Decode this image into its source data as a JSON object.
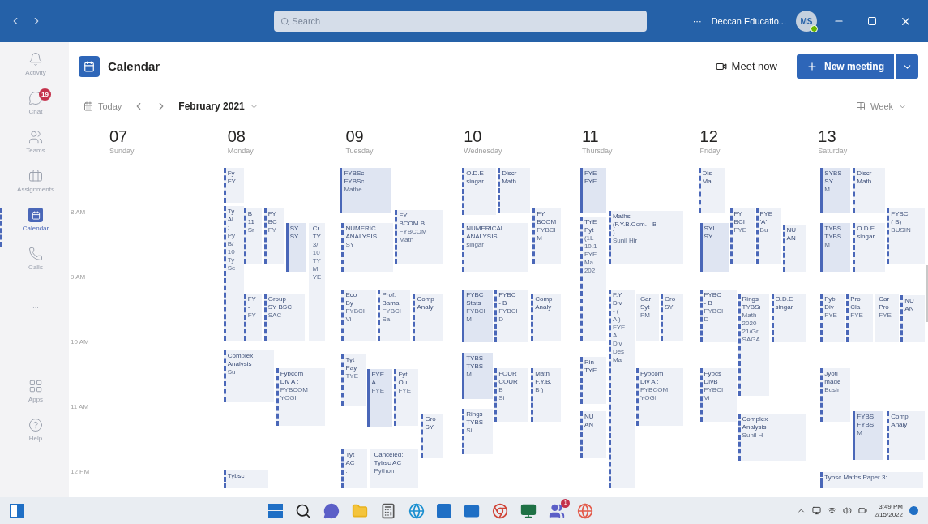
{
  "title_bar": {
    "search_placeholder": "Search",
    "more": "···",
    "org": "Deccan Educatio...",
    "avatar": "MS"
  },
  "rail": [
    {
      "label": "Activity",
      "selected": false
    },
    {
      "label": "Chat",
      "selected": false,
      "badge": "19"
    },
    {
      "label": "Teams",
      "selected": false
    },
    {
      "label": "Assignments",
      "selected": false
    },
    {
      "label": "Calendar",
      "selected": true
    },
    {
      "label": "Calls",
      "selected": false
    },
    {
      "label": "···",
      "selected": false
    },
    {
      "label": "Apps",
      "selected": false
    },
    {
      "label": "Help",
      "selected": false
    }
  ],
  "header": {
    "title": "Calendar",
    "meet_now": "Meet now",
    "new_meeting": "New meeting"
  },
  "toolbar": {
    "today": "Today",
    "month": "February 2021",
    "view": "Week"
  },
  "hours": [
    "8 AM",
    "9 AM",
    "10 AM",
    "11 AM",
    "12 PM"
  ],
  "days": [
    {
      "date": "07",
      "weekday": "Sunday"
    },
    {
      "date": "08",
      "weekday": "Monday",
      "events": [
        {
          "lines": [
            "Fy",
            "FY"
          ],
          "kind": "tentative"
        },
        {
          "lines": [
            "Ty",
            "Al",
            ":",
            "Py",
            "B/",
            "10",
            "Ty",
            "Se"
          ],
          "kind": "tentative"
        },
        {
          "lines": [
            "B",
            "11",
            "Sr"
          ],
          "kind": "tentative"
        },
        {
          "lines": [
            "FY",
            "BC",
            "FY"
          ],
          "kind": "tentative"
        },
        {
          "lines": [
            "SY",
            "SY"
          ],
          "kind": "accepted"
        },
        {
          "lines": [
            "Cr",
            "TY",
            "3/",
            "10",
            "TY",
            "M",
            "YE"
          ],
          "kind": "plain"
        },
        {
          "lines": [
            "FY",
            "-",
            "FY"
          ],
          "kind": "tentative"
        },
        {
          "lines": [
            "Group",
            "SY BSC",
            "SAC"
          ],
          "kind": "tentative"
        },
        {
          "lines": [
            "Complex",
            "Analysis",
            "Su"
          ],
          "kind": "tentative"
        },
        {
          "lines": [
            "Fybcom",
            "Div A :",
            "FYBCOM",
            "YOGI"
          ],
          "kind": "tentative"
        },
        {
          "lines": [
            "Tybsc"
          ],
          "kind": "tentative"
        }
      ]
    },
    {
      "date": "09",
      "weekday": "Tuesday",
      "events": [
        {
          "lines": [
            "FYBSc",
            "FYBSc",
            "Mathe"
          ],
          "kind": "accepted"
        },
        {
          "lines": [
            "FY",
            "BCOM B",
            "FYBCOM",
            "Math"
          ],
          "kind": "tentative"
        },
        {
          "lines": [
            "NUMERIC",
            "ANALYSIS",
            "SY"
          ],
          "kind": "tentative"
        },
        {
          "lines": [
            "Eco",
            "By",
            "FYBCI",
            "Vi"
          ],
          "kind": "tentative"
        },
        {
          "lines": [
            "Prof.",
            "Bama",
            "FYBCI",
            "Sa"
          ],
          "kind": "tentative"
        },
        {
          "lines": [
            "Comp",
            "Analy"
          ],
          "kind": "tentative"
        },
        {
          "lines": [
            "Tyt",
            "Pay",
            "TYE"
          ],
          "kind": "tentative"
        },
        {
          "lines": [
            "FYE",
            "A",
            "FYE"
          ],
          "kind": "accepted"
        },
        {
          "lines": [
            "Fyt",
            "Ou",
            "FYE"
          ],
          "kind": "tentative"
        },
        {
          "lines": [
            "Gro",
            "SY"
          ],
          "kind": "tentative"
        },
        {
          "lines": [
            "Tyt",
            "AC",
            ":"
          ],
          "kind": "tentative"
        },
        {
          "lines": [
            "Canceled:",
            "Tybsc AC",
            "Python"
          ],
          "kind": "plain"
        }
      ]
    },
    {
      "date": "10",
      "weekday": "Wednesday",
      "events": [
        {
          "lines": [
            "O.D.E",
            "singar"
          ],
          "kind": "tentative"
        },
        {
          "lines": [
            "Discr",
            "Math"
          ],
          "kind": "tentative"
        },
        {
          "lines": [
            "FY",
            "BCOM",
            "FYBCI",
            "M"
          ],
          "kind": "tentative"
        },
        {
          "lines": [
            "NUMERICAL",
            "ANALYSIS",
            "singar"
          ],
          "kind": "tentative"
        },
        {
          "lines": [
            "FYBC",
            "Stats",
            "FYBCI",
            "M"
          ],
          "kind": "accepted"
        },
        {
          "lines": [
            "FYBC",
            "- B",
            "FYBCI",
            "D"
          ],
          "kind": "tentative"
        },
        {
          "lines": [
            "Comp",
            "Analy"
          ],
          "kind": "tentative"
        },
        {
          "lines": [
            "TYBS",
            "TYBS",
            "M"
          ],
          "kind": "accepted"
        },
        {
          "lines": [
            "FOUR",
            "COUR",
            "B",
            "Si"
          ],
          "kind": "tentative"
        },
        {
          "lines": [
            "Math",
            "F.Y.B.",
            "B )"
          ],
          "kind": "tentative"
        },
        {
          "lines": [
            "Rings",
            "TYBS",
            "Si"
          ],
          "kind": "tentative"
        }
      ]
    },
    {
      "date": "11",
      "weekday": "Thursday",
      "events": [
        {
          "lines": [
            "FYE",
            "FYE"
          ],
          "kind": "accepted"
        },
        {
          "lines": [
            "TYE",
            "Pyt",
            "(1L",
            "10.1",
            "FYE",
            "Ma",
            "202"
          ],
          "kind": "tentative"
        },
        {
          "lines": [
            "Maths",
            "(F.Y.B.Com. - B",
            ")",
            "Sunil Hir"
          ],
          "kind": "tentative"
        },
        {
          "lines": [
            "F.Y.",
            "Div",
            "- (",
            "A )",
            "FYE",
            "A",
            "Div",
            "Des",
            "Ma"
          ],
          "kind": "tentative"
        },
        {
          "lines": [
            "Gar",
            "Syt",
            "PM"
          ],
          "kind": "plain"
        },
        {
          "lines": [
            "Gro",
            "SY"
          ],
          "kind": "tentative"
        },
        {
          "lines": [
            "Rin",
            "TYE"
          ],
          "kind": "tentative"
        },
        {
          "lines": [
            "Fybcom",
            "Div A :",
            "FYBCOM",
            "YOGI"
          ],
          "kind": "tentative"
        },
        {
          "lines": [
            "NU",
            "AN"
          ],
          "kind": "tentative"
        }
      ]
    },
    {
      "date": "12",
      "weekday": "Friday",
      "events": [
        {
          "lines": [
            "Dis",
            "Ma"
          ],
          "kind": "tentative"
        },
        {
          "lines": [
            "SYI",
            "SY"
          ],
          "kind": "accepted"
        },
        {
          "lines": [
            "FY",
            "BCI",
            "FYE"
          ],
          "kind": "tentative"
        },
        {
          "lines": [
            "FYE",
            "'A'",
            "Bu"
          ],
          "kind": "tentative"
        },
        {
          "lines": [
            "NU",
            "AN"
          ],
          "kind": "tentative"
        },
        {
          "lines": [
            "FYBC",
            "- B",
            "FYBCI",
            "D"
          ],
          "kind": "tentative"
        },
        {
          "lines": [
            "Rings",
            "TYBSı",
            "Math",
            "2020-",
            "21/Gr",
            "SAGA"
          ],
          "kind": "tentative"
        },
        {
          "lines": [
            "O.D.E",
            "singar"
          ],
          "kind": "tentative"
        },
        {
          "lines": [
            "Fybcs",
            "DivB",
            "FYBCI",
            "Vi"
          ],
          "kind": "tentative"
        },
        {
          "lines": [
            "Complex",
            "Analysis",
            "Sunil H"
          ],
          "kind": "tentative"
        }
      ]
    },
    {
      "date": "13",
      "weekday": "Saturday",
      "events": [
        {
          "lines": [
            "SYBS-",
            "SY",
            "M"
          ],
          "kind": "accepted"
        },
        {
          "lines": [
            "Discr",
            "Math"
          ],
          "kind": "tentative"
        },
        {
          "lines": [
            "FYBC",
            "( B)",
            "BUSIN"
          ],
          "kind": "tentative"
        },
        {
          "lines": [
            "TYBS",
            "TYBS",
            "M"
          ],
          "kind": "accepted"
        },
        {
          "lines": [
            "O.D.E",
            "singar"
          ],
          "kind": "tentative"
        },
        {
          "lines": [
            "Fyb",
            "Div",
            "FYE"
          ],
          "kind": "tentative"
        },
        {
          "lines": [
            "Pro",
            "Cla",
            "FYE"
          ],
          "kind": "tentative"
        },
        {
          "lines": [
            "Car",
            "Pro",
            "FYE"
          ],
          "kind": "plain"
        },
        {
          "lines": [
            "NU",
            "AN"
          ],
          "kind": "tentative"
        },
        {
          "lines": [
            "Jyoti",
            "made",
            "Busin"
          ],
          "kind": "tentative"
        },
        {
          "lines": [
            "FYBS",
            "FYBS",
            "M"
          ],
          "kind": "accepted"
        },
        {
          "lines": [
            "Comp",
            "Analy"
          ],
          "kind": "tentative"
        },
        {
          "lines": [
            "Tybsc Maths Paper 3:"
          ],
          "kind": "tentative"
        }
      ]
    }
  ],
  "taskbar": {
    "time": "3:49 PM",
    "date": "2/15/2022",
    "teams_badge": "1"
  }
}
